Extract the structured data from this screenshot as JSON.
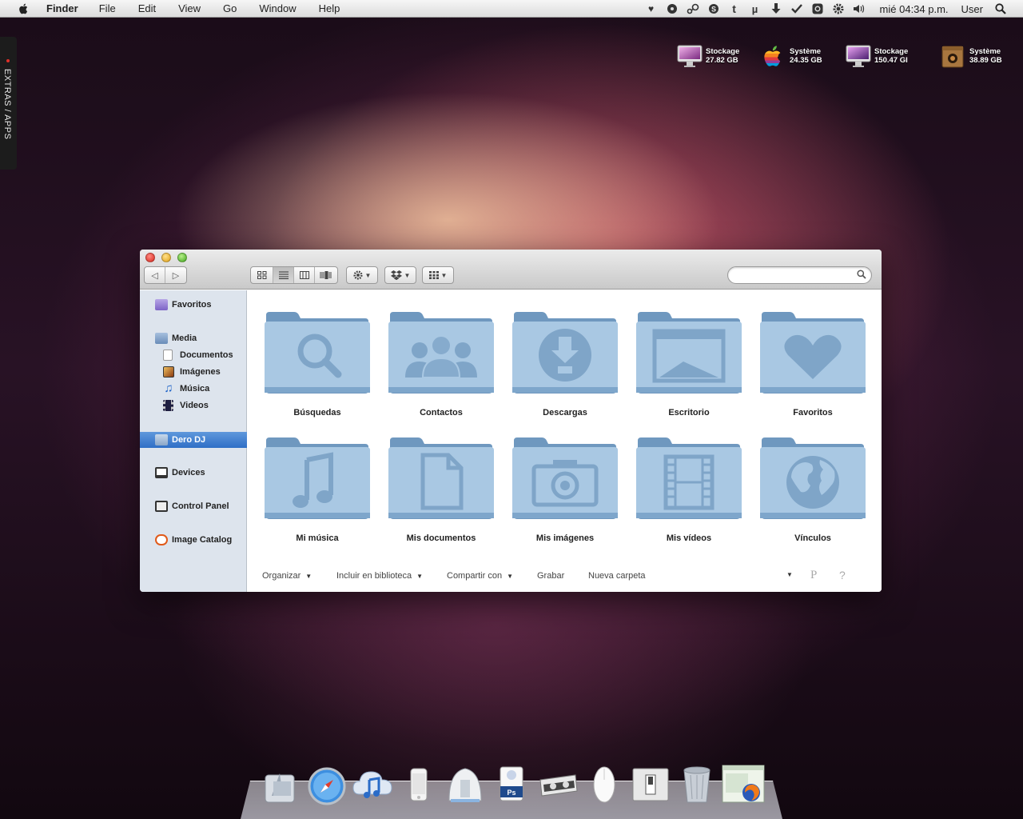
{
  "menubar": {
    "app_name": "Finder",
    "menus": [
      "File",
      "Edit",
      "View",
      "Go",
      "Window",
      "Help"
    ],
    "clock": "mié 04:34 p.m.",
    "user": "User",
    "status_icons": [
      "heart-icon",
      "record-icon",
      "steam-icon",
      "skype-icon",
      "tumblr-icon",
      "utorrent-icon",
      "download-icon",
      "checkmark-icon",
      "camera-icon",
      "gear-icon",
      "volume-icon"
    ]
  },
  "side_tab": {
    "label": "EXTRAS / APPS"
  },
  "drives": [
    {
      "name": "Stockage",
      "size": "27.82 GB",
      "icon": "imac-icon"
    },
    {
      "name": "Système",
      "size": "24.35 GB",
      "icon": "apple-icon"
    },
    {
      "name": "Stockage",
      "size": "150.47 GI",
      "icon": "imac-icon"
    },
    {
      "name": "Système",
      "size": "38.89 GB",
      "icon": "wooden-box-icon"
    }
  ],
  "window": {
    "search_placeholder": "",
    "sidebar": [
      {
        "label": "Favoritos",
        "icon": "favorites-icon"
      },
      {
        "label": "Media",
        "icon": "media-icon"
      },
      {
        "label": "Documentos",
        "icon": "document-icon"
      },
      {
        "label": "Imágenes",
        "icon": "images-icon"
      },
      {
        "label": "Música",
        "icon": "music-icon"
      },
      {
        "label": "Videos",
        "icon": "video-icon"
      },
      {
        "label": "Dero DJ",
        "icon": "home-icon"
      },
      {
        "label": "Devices",
        "icon": "computer-icon"
      },
      {
        "label": "Control Panel",
        "icon": "control-panel-icon"
      },
      {
        "label": "Image Catalog",
        "icon": "image-catalog-icon"
      }
    ],
    "folders": [
      {
        "label": "Búsquedas",
        "icon": "search-icon"
      },
      {
        "label": "Contactos",
        "icon": "contacts-icon"
      },
      {
        "label": "Descargas",
        "icon": "downloads-icon"
      },
      {
        "label": "Escritorio",
        "icon": "desktop-icon"
      },
      {
        "label": "Favoritos",
        "icon": "heart-icon"
      },
      {
        "label": "Mi música",
        "icon": "music-note-icon"
      },
      {
        "label": "Mis documentos",
        "icon": "document-icon"
      },
      {
        "label": "Mis imágenes",
        "icon": "camera-icon"
      },
      {
        "label": "Mis vídeos",
        "icon": "film-icon"
      },
      {
        "label": "Vínculos",
        "icon": "globe-icon"
      }
    ],
    "bottombar": {
      "organize": "Organizar",
      "include": "Incluir en biblioteca",
      "share": "Compartir con",
      "burn": "Grabar",
      "new_folder": "Nueva carpeta",
      "p_label": "P",
      "help_label": "?"
    }
  },
  "dock": [
    "migration-icon",
    "safari-icon",
    "itunes-icon",
    "iphone-icon",
    "time-machine-icon",
    "photoshop-icon",
    "tape-icon",
    "mouse-icon",
    "switch-icon",
    "trash-icon",
    "firefox-icon"
  ]
}
